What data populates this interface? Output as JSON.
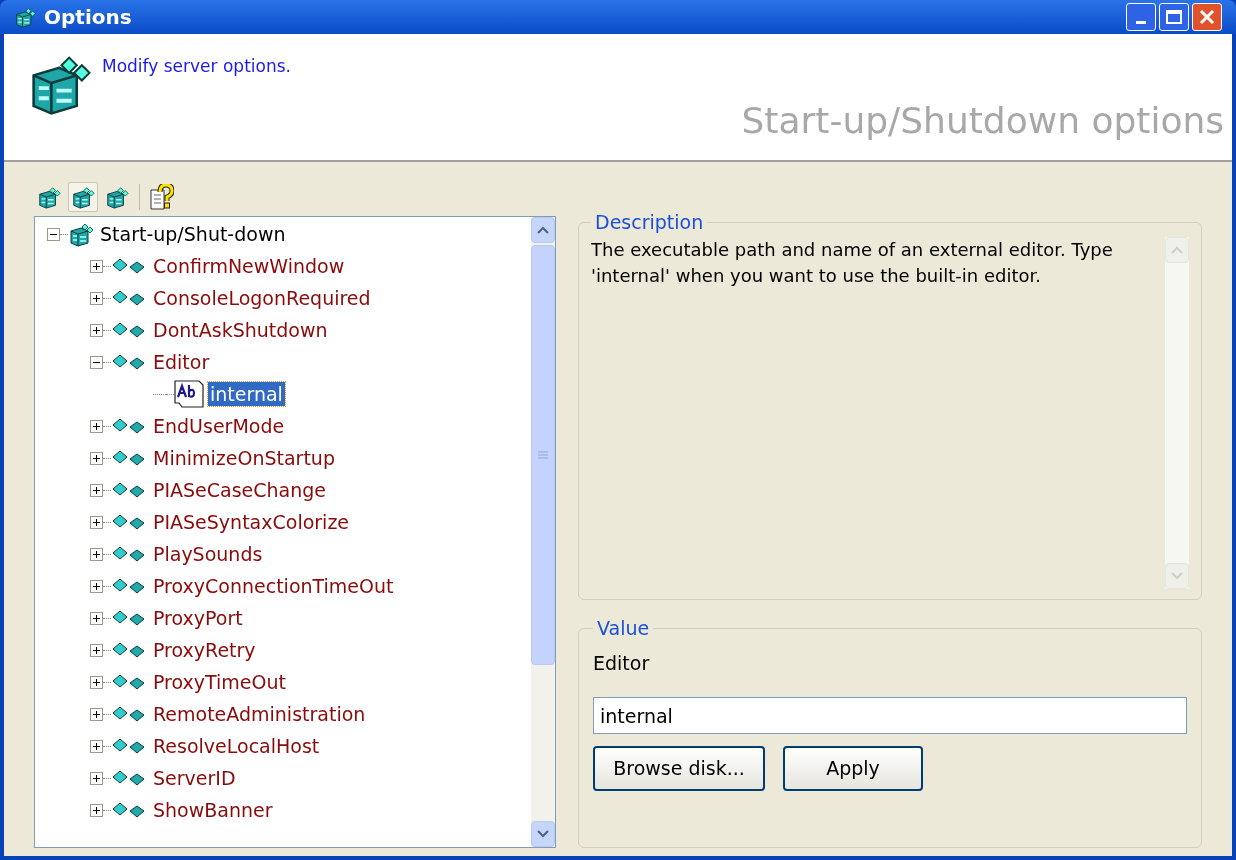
{
  "window": {
    "title": "Options"
  },
  "header": {
    "subtitle": "Modify server options.",
    "section_title": "Start-up/Shutdown options"
  },
  "toolbar": [
    {
      "kind": "group",
      "selected": false
    },
    {
      "kind": "group",
      "selected": true
    },
    {
      "kind": "group",
      "selected": false
    },
    {
      "kind": "separator"
    },
    {
      "kind": "help",
      "selected": false
    }
  ],
  "tree": [
    {
      "kind": "root",
      "label": "Start-up/Shut-down",
      "expanded": true,
      "selected": false,
      "children": [
        {
          "kind": "option",
          "label": "ConfirmNewWindow",
          "expanded": false,
          "selected": false
        },
        {
          "kind": "option",
          "label": "ConsoleLogonRequired",
          "expanded": false,
          "selected": false
        },
        {
          "kind": "option",
          "label": "DontAskShutdown",
          "expanded": false,
          "selected": false
        },
        {
          "kind": "option",
          "label": "Editor",
          "expanded": true,
          "selected": false,
          "children": [
            {
              "kind": "value",
              "label": "internal",
              "selected": true
            }
          ]
        },
        {
          "kind": "option",
          "label": "EndUserMode",
          "expanded": false,
          "selected": false
        },
        {
          "kind": "option",
          "label": "MinimizeOnStartup",
          "expanded": false,
          "selected": false
        },
        {
          "kind": "option",
          "label": "PIASeCaseChange",
          "expanded": false,
          "selected": false
        },
        {
          "kind": "option",
          "label": "PIASeSyntaxColorize",
          "expanded": false,
          "selected": false
        },
        {
          "kind": "option",
          "label": "PlaySounds",
          "expanded": false,
          "selected": false
        },
        {
          "kind": "option",
          "label": "ProxyConnectionTimeOut",
          "expanded": false,
          "selected": false
        },
        {
          "kind": "option",
          "label": "ProxyPort",
          "expanded": false,
          "selected": false
        },
        {
          "kind": "option",
          "label": "ProxyRetry",
          "expanded": false,
          "selected": false
        },
        {
          "kind": "option",
          "label": "ProxyTimeOut",
          "expanded": false,
          "selected": false
        },
        {
          "kind": "option",
          "label": "RemoteAdministration",
          "expanded": false,
          "selected": false
        },
        {
          "kind": "option",
          "label": "ResolveLocalHost",
          "expanded": false,
          "selected": false
        },
        {
          "kind": "option",
          "label": "ServerID",
          "expanded": false,
          "selected": false
        },
        {
          "kind": "option",
          "label": "ShowBanner",
          "expanded": false,
          "selected": false
        }
      ]
    }
  ],
  "description": {
    "title": "Description",
    "text": "The executable path and name of an external editor. Type 'internal' when you want to use the built-in editor."
  },
  "value": {
    "title": "Value",
    "name": "Editor",
    "field_value": "internal",
    "buttons": [
      "Browse disk...",
      "Apply"
    ]
  }
}
